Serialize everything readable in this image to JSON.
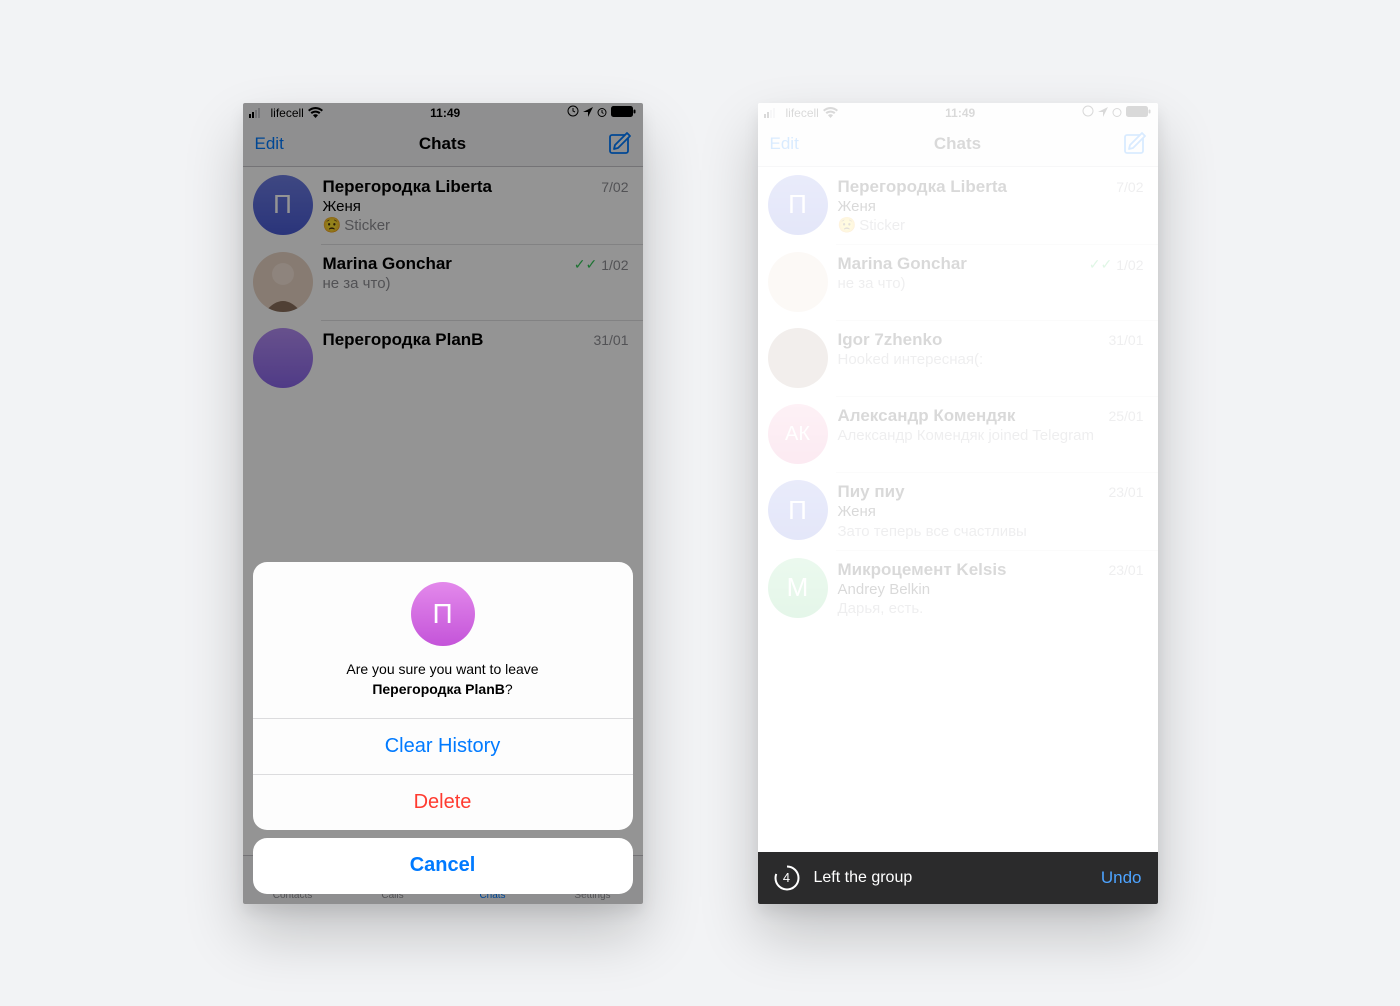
{
  "status": {
    "carrier": "lifecell",
    "time": "11:49"
  },
  "nav": {
    "edit": "Edit",
    "title": "Chats"
  },
  "tabs": {
    "contacts": "Contacts",
    "calls": "Calls",
    "chats": "Chats",
    "settings": "Settings"
  },
  "chats_a": {
    "r0": {
      "name": "Перегородка Liberta",
      "date": "7/02",
      "sender": "Женя",
      "preview": "Sticker",
      "avatar_letter": "П",
      "avatar_bg": "linear-gradient(180deg,#6C7CE0 0%,#4A5BD4 100%)"
    },
    "r1": {
      "name": "Marina Gonchar",
      "date": "1/02",
      "preview": "не за что)",
      "avatar_letter": "",
      "avatar_bg": "#E2C9B8",
      "read": true
    },
    "r2": {
      "name": "Перегородка PlanB",
      "date": "31/01",
      "avatar_letter": "",
      "avatar_bg": "linear-gradient(180deg,#B28CF2 0%,#8A66E8 100%)"
    }
  },
  "chats_b": {
    "r0": {
      "name": "Перегородка Liberta",
      "date": "7/02",
      "sender": "Женя",
      "preview": "Sticker",
      "avatar_letter": "П",
      "avatar_bg": "linear-gradient(180deg,#6C7CE0 0%,#4A5BD4 100%)"
    },
    "r1": {
      "name": "Marina Gonchar",
      "date": "1/02",
      "preview": "не за что)",
      "avatar_letter": "",
      "avatar_bg": "#E2C9B8",
      "read": true
    },
    "r2": {
      "name": "Igor 7zhenko",
      "date": "31/01",
      "preview": "Hooked интересная(:",
      "avatar_letter": "",
      "avatar_bg": "#B7A18F"
    },
    "r3": {
      "name": "Александр Комендяк",
      "date": "25/01",
      "preview": "Александр Комендяк joined Telegram",
      "avatar_letter": "АК",
      "avatar_bg": "linear-gradient(180deg,#F3A0C0 0%,#E774A5 100%)"
    },
    "r4": {
      "name": "Пиу пиу",
      "date": "23/01",
      "sender": "Женя",
      "preview": "Зато теперь все счастливы",
      "avatar_letter": "П",
      "avatar_bg": "linear-gradient(180deg,#6C7CE0 0%,#4A5BD4 100%)"
    },
    "r5": {
      "name": "Микроцемент Kelsis",
      "date": "23/01",
      "sender": "Andrey Belkin",
      "preview": "Дарья, есть.",
      "avatar_letter": "М",
      "avatar_bg": "linear-gradient(180deg,#7BD88F 0%,#4CBF6B 100%)"
    }
  },
  "sheet": {
    "avatar_letter": "П",
    "msg_line1": "Are you sure you want to leave",
    "msg_line2_bold": "Перегородка PlanB",
    "msg_line2_q": "?",
    "clear": "Clear History",
    "delete": "Delete",
    "cancel": "Cancel"
  },
  "toast": {
    "count": "4",
    "label": "Left the group",
    "undo": "Undo"
  }
}
